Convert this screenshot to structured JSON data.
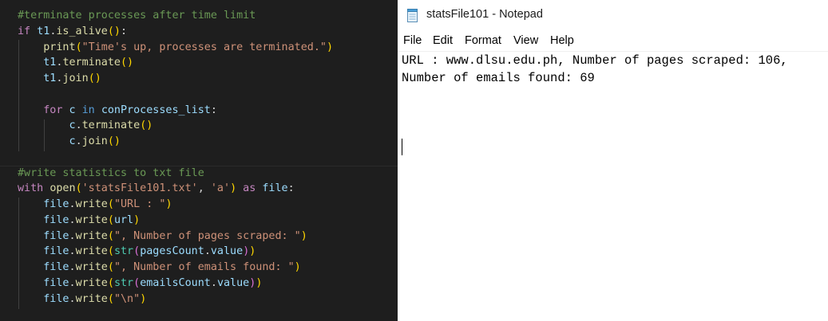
{
  "editor": {
    "lines": [
      {
        "segments": [
          {
            "cls": "c-comment",
            "text": "#terminate processes after time limit"
          }
        ]
      },
      {
        "segments": [
          {
            "cls": "c-kw",
            "text": "if "
          },
          {
            "cls": "c-var",
            "text": "t1"
          },
          {
            "cls": "",
            "text": "."
          },
          {
            "cls": "c-fn",
            "text": "is_alive"
          },
          {
            "cls": "c-br1",
            "text": "()"
          },
          {
            "cls": "",
            "text": ":"
          }
        ]
      },
      {
        "segments": [
          {
            "cls": "",
            "text": "    "
          },
          {
            "cls": "c-fn",
            "text": "print"
          },
          {
            "cls": "c-br1",
            "text": "("
          },
          {
            "cls": "c-str",
            "text": "\"Time's up, processes are terminated.\""
          },
          {
            "cls": "c-br1",
            "text": ")"
          }
        ]
      },
      {
        "segments": [
          {
            "cls": "",
            "text": "    "
          },
          {
            "cls": "c-var",
            "text": "t1"
          },
          {
            "cls": "",
            "text": "."
          },
          {
            "cls": "c-fn",
            "text": "terminate"
          },
          {
            "cls": "c-br1",
            "text": "()"
          }
        ]
      },
      {
        "segments": [
          {
            "cls": "",
            "text": "    "
          },
          {
            "cls": "c-var",
            "text": "t1"
          },
          {
            "cls": "",
            "text": "."
          },
          {
            "cls": "c-fn",
            "text": "join"
          },
          {
            "cls": "c-br1",
            "text": "()"
          }
        ]
      },
      {
        "segments": []
      },
      {
        "segments": [
          {
            "cls": "",
            "text": "    "
          },
          {
            "cls": "c-kw",
            "text": "for "
          },
          {
            "cls": "c-var",
            "text": "c"
          },
          {
            "cls": "c-ctl",
            "text": " in "
          },
          {
            "cls": "c-var",
            "text": "conProcesses_list"
          },
          {
            "cls": "",
            "text": ":"
          }
        ]
      },
      {
        "segments": [
          {
            "cls": "",
            "text": "        "
          },
          {
            "cls": "c-var",
            "text": "c"
          },
          {
            "cls": "",
            "text": "."
          },
          {
            "cls": "c-fn",
            "text": "terminate"
          },
          {
            "cls": "c-br1",
            "text": "()"
          }
        ]
      },
      {
        "segments": [
          {
            "cls": "",
            "text": "        "
          },
          {
            "cls": "c-var",
            "text": "c"
          },
          {
            "cls": "",
            "text": "."
          },
          {
            "cls": "c-fn",
            "text": "join"
          },
          {
            "cls": "c-br1",
            "text": "()"
          }
        ]
      },
      {
        "segments": []
      },
      {
        "segments": [
          {
            "cls": "c-comment",
            "text": "#write statistics to txt file"
          }
        ]
      },
      {
        "segments": [
          {
            "cls": "c-kw",
            "text": "with "
          },
          {
            "cls": "c-fn",
            "text": "open"
          },
          {
            "cls": "c-br1",
            "text": "("
          },
          {
            "cls": "c-str",
            "text": "'statsFile101.txt'"
          },
          {
            "cls": "",
            "text": ", "
          },
          {
            "cls": "c-str",
            "text": "'a'"
          },
          {
            "cls": "c-br1",
            "text": ")"
          },
          {
            "cls": "c-kw",
            "text": " as "
          },
          {
            "cls": "c-var",
            "text": "file"
          },
          {
            "cls": "",
            "text": ":"
          }
        ]
      },
      {
        "segments": [
          {
            "cls": "",
            "text": "    "
          },
          {
            "cls": "c-var",
            "text": "file"
          },
          {
            "cls": "",
            "text": "."
          },
          {
            "cls": "c-fn",
            "text": "write"
          },
          {
            "cls": "c-br1",
            "text": "("
          },
          {
            "cls": "c-str",
            "text": "\"URL : \""
          },
          {
            "cls": "c-br1",
            "text": ")"
          }
        ]
      },
      {
        "segments": [
          {
            "cls": "",
            "text": "    "
          },
          {
            "cls": "c-var",
            "text": "file"
          },
          {
            "cls": "",
            "text": "."
          },
          {
            "cls": "c-fn",
            "text": "write"
          },
          {
            "cls": "c-br1",
            "text": "("
          },
          {
            "cls": "c-var",
            "text": "url"
          },
          {
            "cls": "c-br1",
            "text": ")"
          }
        ]
      },
      {
        "segments": [
          {
            "cls": "",
            "text": "    "
          },
          {
            "cls": "c-var",
            "text": "file"
          },
          {
            "cls": "",
            "text": "."
          },
          {
            "cls": "c-fn",
            "text": "write"
          },
          {
            "cls": "c-br1",
            "text": "("
          },
          {
            "cls": "c-str",
            "text": "\", Number of pages scraped: \""
          },
          {
            "cls": "c-br1",
            "text": ")"
          }
        ]
      },
      {
        "segments": [
          {
            "cls": "",
            "text": "    "
          },
          {
            "cls": "c-var",
            "text": "file"
          },
          {
            "cls": "",
            "text": "."
          },
          {
            "cls": "c-fn",
            "text": "write"
          },
          {
            "cls": "c-br1",
            "text": "("
          },
          {
            "cls": "c-type",
            "text": "str"
          },
          {
            "cls": "c-br2",
            "text": "("
          },
          {
            "cls": "c-var",
            "text": "pagesCount"
          },
          {
            "cls": "",
            "text": "."
          },
          {
            "cls": "c-var",
            "text": "value"
          },
          {
            "cls": "c-br2",
            "text": ")"
          },
          {
            "cls": "c-br1",
            "text": ")"
          }
        ]
      },
      {
        "segments": [
          {
            "cls": "",
            "text": "    "
          },
          {
            "cls": "c-var",
            "text": "file"
          },
          {
            "cls": "",
            "text": "."
          },
          {
            "cls": "c-fn",
            "text": "write"
          },
          {
            "cls": "c-br1",
            "text": "("
          },
          {
            "cls": "c-str",
            "text": "\", Number of emails found: \""
          },
          {
            "cls": "c-br1",
            "text": ")"
          }
        ]
      },
      {
        "segments": [
          {
            "cls": "",
            "text": "    "
          },
          {
            "cls": "c-var",
            "text": "file"
          },
          {
            "cls": "",
            "text": "."
          },
          {
            "cls": "c-fn",
            "text": "write"
          },
          {
            "cls": "c-br1",
            "text": "("
          },
          {
            "cls": "c-type",
            "text": "str"
          },
          {
            "cls": "c-br2",
            "text": "("
          },
          {
            "cls": "c-var",
            "text": "emailsCount"
          },
          {
            "cls": "",
            "text": "."
          },
          {
            "cls": "c-var",
            "text": "value"
          },
          {
            "cls": "c-br2",
            "text": ")"
          },
          {
            "cls": "c-br1",
            "text": ")"
          }
        ]
      },
      {
        "segments": [
          {
            "cls": "",
            "text": "    "
          },
          {
            "cls": "c-var",
            "text": "file"
          },
          {
            "cls": "",
            "text": "."
          },
          {
            "cls": "c-fn",
            "text": "write"
          },
          {
            "cls": "c-br1",
            "text": "("
          },
          {
            "cls": "c-str",
            "text": "\"\\n\""
          },
          {
            "cls": "c-br1",
            "text": ")"
          }
        ]
      }
    ]
  },
  "notepad": {
    "icon": "notepad-icon",
    "title": "statsFile101 - Notepad",
    "menu": [
      "File",
      "Edit",
      "Format",
      "View",
      "Help"
    ],
    "content_lines": [
      "URL : www.dlsu.edu.ph, Number of pages scraped: 106,",
      "Number of emails found: 69"
    ]
  },
  "colors": {
    "editor_bg": "#1e1e1e",
    "comment": "#6a9955",
    "keyword": "#c586c0",
    "function": "#dcdcaa",
    "variable": "#9cdcfe",
    "string": "#ce9178",
    "type": "#4ec9b0",
    "bracket1": "#ffd700",
    "bracket2": "#da70d6"
  }
}
